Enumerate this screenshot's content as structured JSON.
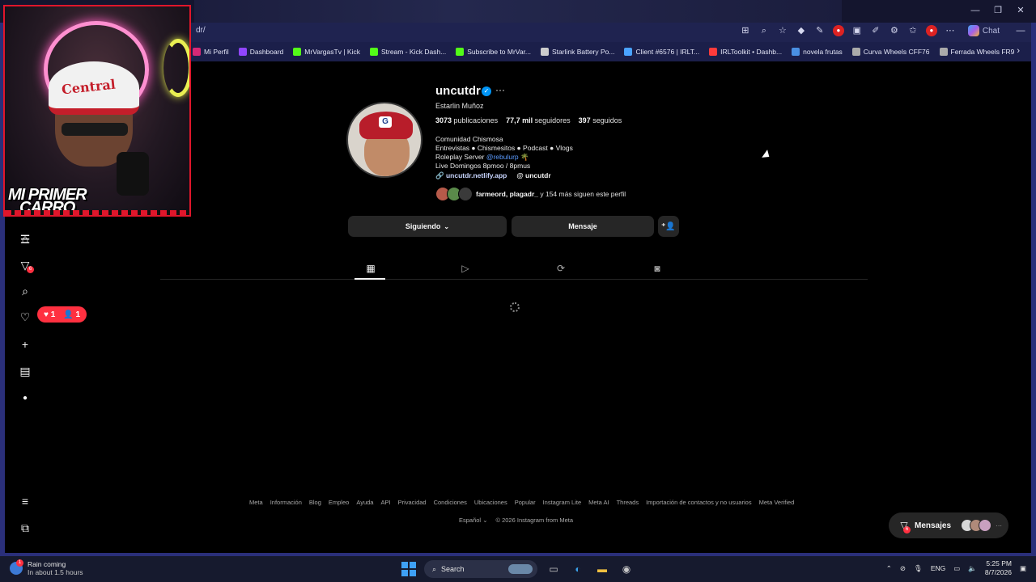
{
  "browser": {
    "url": "dr/",
    "copilot_label": "Chat",
    "bookmarks": [
      {
        "label": "Mi Perfil",
        "icon": "instagram-icon",
        "color": "#d62976"
      },
      {
        "label": "Dashboard",
        "icon": "twitch-icon",
        "color": "#9146ff"
      },
      {
        "label": "MrVargasTv | Kick",
        "icon": "kick-icon",
        "color": "#53fc18"
      },
      {
        "label": "Stream - Kick Dash...",
        "icon": "kick-icon",
        "color": "#53fc18"
      },
      {
        "label": "Subscribe to MrVar...",
        "icon": "kick-icon",
        "color": "#53fc18"
      },
      {
        "label": "Starlink Battery Po...",
        "icon": "doc-icon",
        "color": "#cccccc"
      },
      {
        "label": "Client #6576 | IRLT...",
        "icon": "cloud-icon",
        "color": "#4aa3ff"
      },
      {
        "label": "IRLToolkit • Dashb...",
        "icon": "irltoolkit-icon",
        "color": "#ff3b3b"
      },
      {
        "label": "novela frutas",
        "icon": "image-icon",
        "color": "#4a90e2"
      },
      {
        "label": "Curva Wheels CFF76",
        "icon": "wheel-icon",
        "color": "#aaaaaa"
      },
      {
        "label": "Ferrada Wheels FR9",
        "icon": "wheel-icon",
        "color": "#aaaaaa"
      }
    ]
  },
  "webcam": {
    "cap_text": "Central",
    "overlay_line1": "MI PRIMER",
    "overlay_line2": "CARRO"
  },
  "sidebar": {
    "notifications": {
      "likes": "1",
      "follows": "1"
    },
    "badge_count": "6"
  },
  "profile": {
    "username": "uncutdr",
    "full_name": "Estarlin Muñoz",
    "stats": {
      "posts_count": "3073",
      "posts_label": "publicaciones",
      "followers_count": "77,7 mil",
      "followers_label": "seguidores",
      "following_count": "397",
      "following_label": "seguidos"
    },
    "bio": {
      "line1": "Comunidad Chismosa",
      "line2": "Entrevistas ● Chismesitos ● Podcast ● Vlogs",
      "line3_prefix": "Roleplay Server ",
      "line3_mention": "@rebulurp",
      "line3_suffix": " 🌴",
      "line4": "Live Domingos 8pmoo / 8pmus"
    },
    "link": "uncutdr.netlify.app",
    "threads_handle": "uncutdr",
    "followed_by_names": "farmeord, plagadr_",
    "followed_by_suffix": " y 154 más siguen este perfil",
    "buttons": {
      "following": "Siguiendo",
      "message": "Mensaje"
    }
  },
  "footer": {
    "links": [
      "Meta",
      "Información",
      "Blog",
      "Empleo",
      "Ayuda",
      "API",
      "Privacidad",
      "Condiciones",
      "Ubicaciones",
      "Popular",
      "Instagram Lite",
      "Meta AI",
      "Threads",
      "Importación de contactos y no usuarios",
      "Meta Verified"
    ],
    "language": "Español",
    "copyright": "© 2026 Instagram from Meta"
  },
  "messages_bar": {
    "label": "Mensajes",
    "badge": "6"
  },
  "taskbar": {
    "weather_title": "Rain coming",
    "weather_sub": "In about 1.5 hours",
    "weather_badge": "1",
    "search_label": "Search",
    "lang": "ENG",
    "time": "5:25 PM",
    "date": "8/7/2026"
  }
}
